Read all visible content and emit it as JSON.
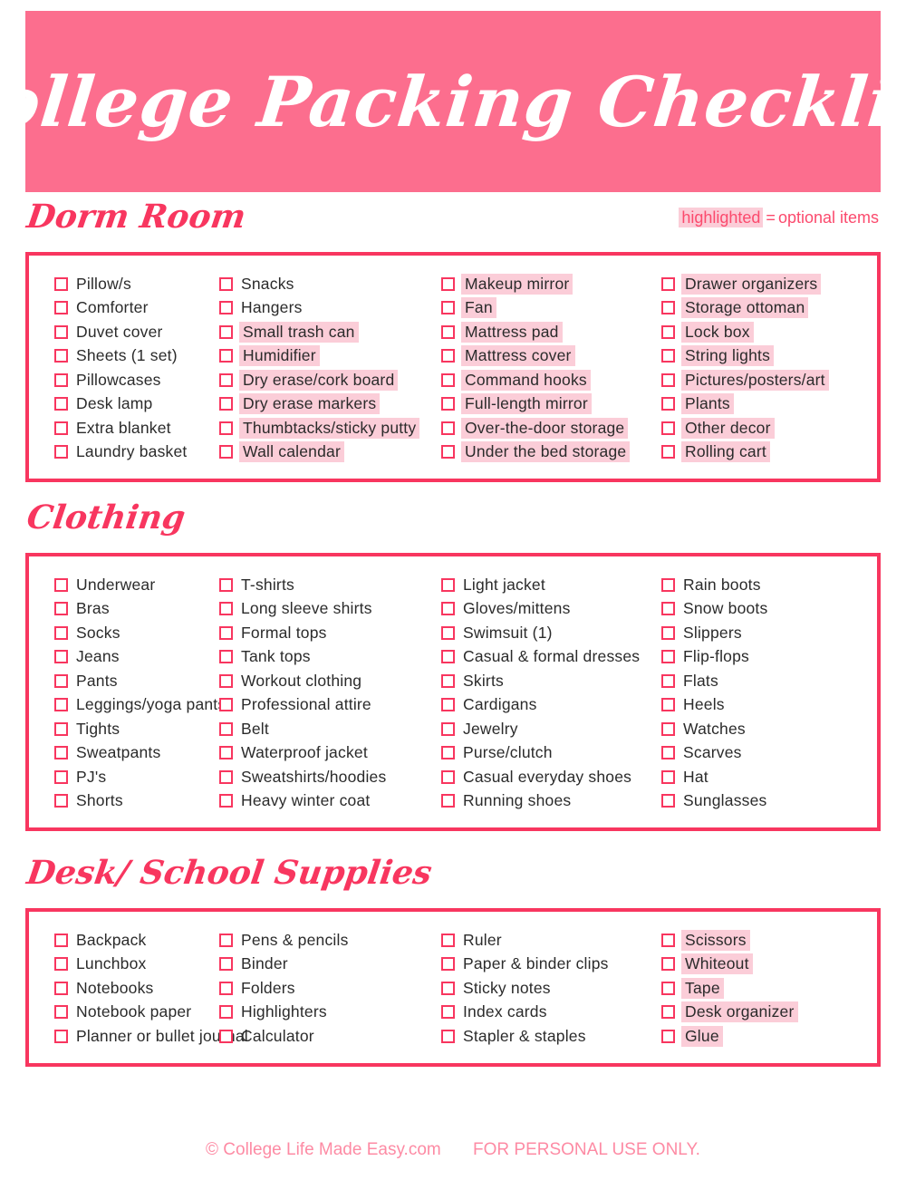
{
  "header": {
    "title": "College Packing Checklist",
    "banner_color": "#fc6e8e"
  },
  "legend": {
    "highlighted_word": "highlighted",
    "equals": "=",
    "description": "optional items"
  },
  "theme": {
    "accent": "#f8365f",
    "banner": "#fc6e8e",
    "highlight": "#fbcdd8",
    "footer_text": "#fd8ba4",
    "item_text": "#2b2b2b"
  },
  "sections": [
    {
      "title": "Dorm Room",
      "columns": [
        [
          {
            "label": "Pillow/s",
            "highlighted": false
          },
          {
            "label": "Comforter",
            "highlighted": false
          },
          {
            "label": "Duvet cover",
            "highlighted": false
          },
          {
            "label": "Sheets (1 set)",
            "highlighted": false
          },
          {
            "label": "Pillowcases",
            "highlighted": false
          },
          {
            "label": "Desk lamp",
            "highlighted": false
          },
          {
            "label": "Extra blanket",
            "highlighted": false
          },
          {
            "label": "Laundry basket",
            "highlighted": false
          }
        ],
        [
          {
            "label": "Snacks",
            "highlighted": false
          },
          {
            "label": "Hangers",
            "highlighted": false
          },
          {
            "label": "Small trash can",
            "highlighted": true
          },
          {
            "label": "Humidifier",
            "highlighted": true
          },
          {
            "label": "Dry erase/cork board",
            "highlighted": true
          },
          {
            "label": "Dry erase markers",
            "highlighted": true
          },
          {
            "label": "Thumbtacks/sticky putty",
            "highlighted": true
          },
          {
            "label": "Wall calendar",
            "highlighted": true
          }
        ],
        [
          {
            "label": "Makeup mirror",
            "highlighted": true
          },
          {
            "label": "Fan",
            "highlighted": true
          },
          {
            "label": "Mattress pad",
            "highlighted": true
          },
          {
            "label": "Mattress cover",
            "highlighted": true
          },
          {
            "label": "Command hooks",
            "highlighted": true
          },
          {
            "label": "Full-length mirror",
            "highlighted": true
          },
          {
            "label": "Over-the-door storage",
            "highlighted": true
          },
          {
            "label": "Under the bed storage",
            "highlighted": true
          }
        ],
        [
          {
            "label": "Drawer organizers",
            "highlighted": true
          },
          {
            "label": "Storage ottoman",
            "highlighted": true
          },
          {
            "label": "Lock box",
            "highlighted": true
          },
          {
            "label": "String lights",
            "highlighted": true
          },
          {
            "label": "Pictures/posters/art",
            "highlighted": true
          },
          {
            "label": "Plants",
            "highlighted": true
          },
          {
            "label": "Other decor",
            "highlighted": true
          },
          {
            "label": "Rolling cart",
            "highlighted": true
          }
        ]
      ]
    },
    {
      "title": "Clothing",
      "columns": [
        [
          {
            "label": "Underwear",
            "highlighted": false
          },
          {
            "label": "Bras",
            "highlighted": false
          },
          {
            "label": "Socks",
            "highlighted": false
          },
          {
            "label": "Jeans",
            "highlighted": false
          },
          {
            "label": "Pants",
            "highlighted": false
          },
          {
            "label": "Leggings/yoga pants",
            "highlighted": false
          },
          {
            "label": "Tights",
            "highlighted": false
          },
          {
            "label": "Sweatpants",
            "highlighted": false
          },
          {
            "label": "PJ's",
            "highlighted": false
          },
          {
            "label": "Shorts",
            "highlighted": false
          }
        ],
        [
          {
            "label": "T-shirts",
            "highlighted": false
          },
          {
            "label": "Long sleeve shirts",
            "highlighted": false
          },
          {
            "label": "Formal tops",
            "highlighted": false
          },
          {
            "label": "Tank tops",
            "highlighted": false
          },
          {
            "label": "Workout clothing",
            "highlighted": false
          },
          {
            "label": "Professional attire",
            "highlighted": false
          },
          {
            "label": "Belt",
            "highlighted": false
          },
          {
            "label": "Waterproof jacket",
            "highlighted": false
          },
          {
            "label": "Sweatshirts/hoodies",
            "highlighted": false
          },
          {
            "label": "Heavy winter coat",
            "highlighted": false
          }
        ],
        [
          {
            "label": "Light jacket",
            "highlighted": false
          },
          {
            "label": "Gloves/mittens",
            "highlighted": false
          },
          {
            "label": "Swimsuit (1)",
            "highlighted": false
          },
          {
            "label": "Casual & formal dresses",
            "highlighted": false
          },
          {
            "label": "Skirts",
            "highlighted": false
          },
          {
            "label": "Cardigans",
            "highlighted": false
          },
          {
            "label": "Jewelry",
            "highlighted": false
          },
          {
            "label": "Purse/clutch",
            "highlighted": false
          },
          {
            "label": "Casual everyday shoes",
            "highlighted": false
          },
          {
            "label": "Running shoes",
            "highlighted": false
          }
        ],
        [
          {
            "label": "Rain boots",
            "highlighted": false
          },
          {
            "label": "Snow boots",
            "highlighted": false
          },
          {
            "label": "Slippers",
            "highlighted": false
          },
          {
            "label": "Flip-flops",
            "highlighted": false
          },
          {
            "label": "Flats",
            "highlighted": false
          },
          {
            "label": "Heels",
            "highlighted": false
          },
          {
            "label": "Watches",
            "highlighted": false
          },
          {
            "label": "Scarves",
            "highlighted": false
          },
          {
            "label": "Hat",
            "highlighted": false
          },
          {
            "label": "Sunglasses",
            "highlighted": false
          }
        ]
      ]
    },
    {
      "title": "Desk/ School Supplies",
      "columns": [
        [
          {
            "label": "Backpack",
            "highlighted": false
          },
          {
            "label": "Lunchbox",
            "highlighted": false
          },
          {
            "label": "Notebooks",
            "highlighted": false
          },
          {
            "label": "Notebook paper",
            "highlighted": false
          },
          {
            "label": "Planner or bullet journal",
            "highlighted": false
          }
        ],
        [
          {
            "label": "Pens & pencils",
            "highlighted": false
          },
          {
            "label": "Binder",
            "highlighted": false
          },
          {
            "label": "Folders",
            "highlighted": false
          },
          {
            "label": "Highlighters",
            "highlighted": false
          },
          {
            "label": "Calculator",
            "highlighted": false
          }
        ],
        [
          {
            "label": "Ruler",
            "highlighted": false
          },
          {
            "label": "Paper & binder clips",
            "highlighted": false
          },
          {
            "label": "Sticky notes",
            "highlighted": false
          },
          {
            "label": "Index cards",
            "highlighted": false
          },
          {
            "label": "Stapler & staples",
            "highlighted": false
          }
        ],
        [
          {
            "label": "Scissors",
            "highlighted": true
          },
          {
            "label": "Whiteout",
            "highlighted": true
          },
          {
            "label": "Tape",
            "highlighted": true
          },
          {
            "label": "Desk organizer",
            "highlighted": true
          },
          {
            "label": "Glue",
            "highlighted": true
          }
        ]
      ]
    }
  ],
  "footer": {
    "copyright": "© College Life Made Easy.com",
    "notice": "FOR PERSONAL USE ONLY."
  }
}
